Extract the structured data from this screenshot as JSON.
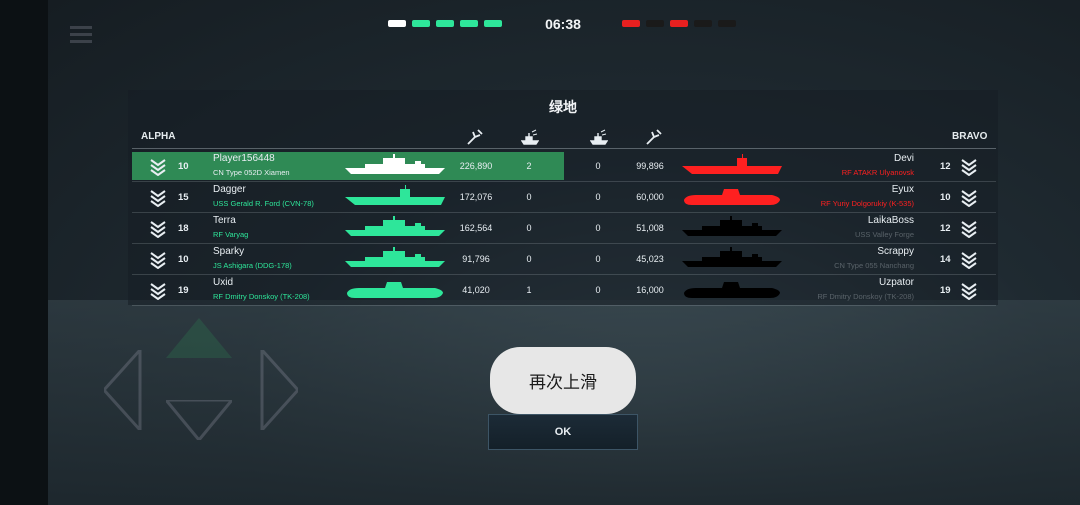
{
  "hud": {
    "timer": "06:38",
    "alpha_segments": [
      "#ffffff",
      "#2ee69a",
      "#2ee69a",
      "#2ee69a",
      "#2ee69a"
    ],
    "bravo_segments": [
      "#e82020",
      "#1a1a1a",
      "#e82020",
      "#1a1a1a",
      "#1a1a1a"
    ]
  },
  "scoreboard": {
    "map_name": "绿地",
    "team_left": "ALPHA",
    "team_right": "BRAVO",
    "column_icons": [
      "damage-dealt-icon",
      "kills-icon",
      "kills-icon",
      "damage-dealt-icon"
    ],
    "colors": {
      "highlight": "#2f8a55",
      "alpha_ship": "#2ee69a",
      "bravo_alive": "#ff2020",
      "bravo_dead": "#000000"
    },
    "alpha": [
      {
        "rank": "10",
        "name": "Player156448",
        "ship": "CN Type 052D Xiamen",
        "damage": "226,890",
        "kills": "2",
        "player_self": true
      },
      {
        "rank": "15",
        "name": "Dagger",
        "ship": "USS Gerald R. Ford (CVN-78)",
        "damage": "172,076",
        "kills": "0"
      },
      {
        "rank": "18",
        "name": "Terra",
        "ship": "RF Varyag",
        "damage": "162,564",
        "kills": "0"
      },
      {
        "rank": "10",
        "name": "Sparky",
        "ship": "JS Ashigara (DDG-178)",
        "damage": "91,796",
        "kills": "0"
      },
      {
        "rank": "19",
        "name": "Uxid",
        "ship": "RF Dmitry Donskoy (TK-208)",
        "damage": "41,020",
        "kills": "1"
      }
    ],
    "bravo": [
      {
        "rank": "12",
        "name": "Devi",
        "ship": "RF ATAKR Ulyanovsk",
        "damage": "99,896",
        "kills": "0",
        "alive": true
      },
      {
        "rank": "10",
        "name": "Eyux",
        "ship": "RF Yuriy Dolgorukiy (K-535)",
        "damage": "60,000",
        "kills": "0",
        "alive": true
      },
      {
        "rank": "12",
        "name": "LaikaBoss",
        "ship": "USS Valley Forge",
        "damage": "51,008",
        "kills": "0",
        "alive": false
      },
      {
        "rank": "14",
        "name": "Scrappy",
        "ship": "CN Type 055 Nanchang",
        "damage": "45,023",
        "kills": "0",
        "alive": false
      },
      {
        "rank": "19",
        "name": "Uzpator",
        "ship": "RF Dmitry Donskoy (TK-208)",
        "damage": "16,000",
        "kills": "0",
        "alive": false
      }
    ]
  },
  "toast": {
    "text": "再次上滑"
  },
  "ok_button": {
    "label": "OK"
  }
}
